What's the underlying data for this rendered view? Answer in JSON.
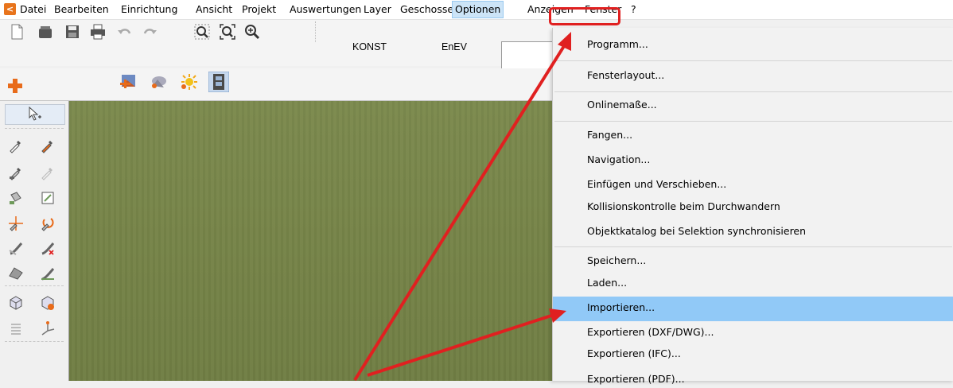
{
  "app": {
    "icon": "app-logo-icon"
  },
  "menubar": {
    "items": [
      "Datei",
      "Bearbeiten",
      "Einrichtung",
      "Ansicht",
      "Projekt",
      "Auswertungen",
      "Layer",
      "Geschosse",
      "Optionen",
      "Anzeigen",
      "Fenster",
      "?"
    ],
    "active": "Optionen"
  },
  "toolbar": {
    "tabs": [
      "KONST",
      "EnEV"
    ]
  },
  "options_menu": {
    "items": [
      "Programm...",
      "Fensterlayout...",
      "Onlinemaße...",
      "Fangen...",
      "Navigation...",
      "Einfügen und Verschieben...",
      "Kollisionskontrolle beim Durchwandern",
      "Objektkatalog bei Selektion synchronisieren",
      "Speichern...",
      "Laden...",
      "Importieren...",
      "Exportieren (DXF/DWG)...",
      "Exportieren (IFC)...",
      "Exportieren (PDF)..."
    ],
    "highlighted": "Importieren..."
  },
  "colors": {
    "annotation": "#e02020",
    "highlight": "#91c9f7",
    "viewport": "#768448"
  }
}
